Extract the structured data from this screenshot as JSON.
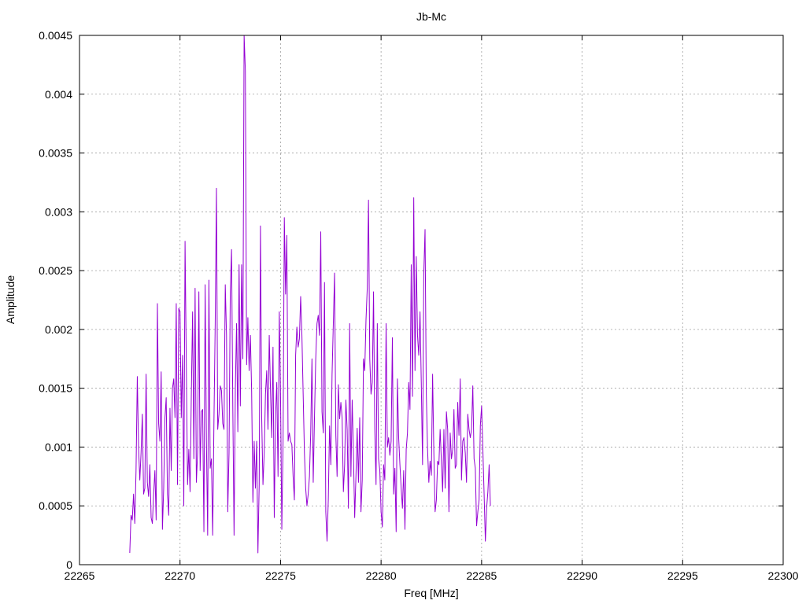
{
  "chart_data": {
    "type": "line",
    "title": "Jb-Mc",
    "xlabel": "Freq [MHz]",
    "ylabel": "Amplitude",
    "xlim": [
      22265,
      22300
    ],
    "ylim": [
      0,
      0.0045
    ],
    "x_ticks": [
      "22265",
      "22270",
      "22275",
      "22280",
      "22285",
      "22290",
      "22295",
      "22300"
    ],
    "y_ticks": [
      "0",
      "0.0005",
      "0.001",
      "0.0015",
      "0.002",
      "0.0025",
      "0.003",
      "0.0035",
      "0.004",
      "0.0045"
    ],
    "grid": true,
    "legend": "none",
    "series": [
      {
        "color": "#9400d3",
        "x_start": 22267.5,
        "x_step": 0.0625,
        "values": [
          0.0001,
          0.00042,
          0.00038,
          0.0006,
          0.00035,
          0.0008,
          0.0016,
          0.001,
          0.00072,
          0.00095,
          0.00128,
          0.0006,
          0.00065,
          0.00162,
          0.0007,
          0.00058,
          0.00085,
          0.0004,
          0.00035,
          0.0006,
          0.0008,
          0.00038,
          0.00222,
          0.0012,
          0.00105,
          0.00164,
          0.0003,
          0.00065,
          0.00125,
          0.00142,
          0.0006,
          0.00042,
          0.00133,
          0.0008,
          0.0015,
          0.00158,
          0.00125,
          0.00222,
          0.00068,
          0.00218,
          0.00215,
          0.00125,
          0.00178,
          0.0005,
          0.00275,
          0.0017,
          0.00068,
          0.00098,
          0.00062,
          0.00145,
          0.00215,
          0.0009,
          0.00235,
          0.0007,
          0.00095,
          0.00232,
          0.0008,
          0.0013,
          0.00132,
          0.00028,
          0.00238,
          0.00105,
          0.00025,
          0.00242,
          0.00082,
          0.0009,
          0.00025,
          0.00122,
          0.00205,
          0.0032,
          0.00115,
          0.00128,
          0.00152,
          0.00148,
          0.0012,
          0.00115,
          0.00238,
          0.00195,
          0.00045,
          0.00095,
          0.00232,
          0.00268,
          0.00135,
          0.00025,
          0.00148,
          0.00205,
          0.00113,
          0.00255,
          0.00135,
          0.00255,
          0.00175,
          0.0045,
          0.0042,
          0.0017,
          0.0021,
          0.00165,
          0.00195,
          0.00147,
          0.00053,
          0.00105,
          0.00065,
          0.00105,
          0.0001,
          0.00068,
          0.00288,
          0.00125,
          0.00068,
          0.00095,
          0.00145,
          0.00165,
          0.00115,
          0.00195,
          0.00148,
          0.00108,
          0.00185,
          0.0004,
          0.00125,
          0.00155,
          0.00075,
          0.00215,
          0.00143,
          0.0003,
          0.00105,
          0.00295,
          0.0023,
          0.0028,
          0.00105,
          0.00112,
          0.00105,
          0.00102,
          0.00075,
          0.00055,
          0.00178,
          0.00202,
          0.00185,
          0.00192,
          0.00228,
          0.00195,
          0.00145,
          0.00095,
          0.00065,
          0.0005,
          0.0006,
          0.00075,
          0.00112,
          0.00175,
          0.0007,
          0.00125,
          0.00175,
          0.00205,
          0.00212,
          0.00195,
          0.00283,
          0.0013,
          0.00112,
          0.0024,
          0.00045,
          0.0002,
          0.00055,
          0.00118,
          0.00085,
          0.00162,
          0.00205,
          0.00248,
          0.0011,
          0.00075,
          0.00153,
          0.00124,
          0.00138,
          0.00125,
          0.00062,
          0.00085,
          0.0014,
          0.00115,
          0.00048,
          0.00205,
          0.00075,
          0.0014,
          0.00095,
          0.0004,
          0.00075,
          0.00116,
          0.0007,
          0.00125,
          0.00045,
          0.00072,
          0.00175,
          0.00165,
          0.00208,
          0.00235,
          0.0031,
          0.00175,
          0.00145,
          0.00155,
          0.00232,
          0.00115,
          0.00068,
          0.00205,
          0.0009,
          0.0008,
          0.00045,
          0.00032,
          0.00085,
          0.00072,
          0.00205,
          0.001,
          0.00108,
          0.00093,
          0.00105,
          0.00193,
          0.0006,
          0.00082,
          0.00028,
          0.00158,
          0.00108,
          0.00085,
          0.00065,
          0.00048,
          0.0008,
          0.0003,
          0.00098,
          0.00112,
          0.00155,
          0.00132,
          0.00255,
          0.00143,
          0.00312,
          0.00165,
          0.00262,
          0.00195,
          0.00178,
          0.00215,
          0.00155,
          0.00085,
          0.00248,
          0.00285,
          0.00145,
          0.00098,
          0.0007,
          0.00088,
          0.00076,
          0.00162,
          0.00095,
          0.00045,
          0.00055,
          0.00088,
          0.00085,
          0.00115,
          0.00088,
          0.00062,
          0.00115,
          0.00065,
          0.0013,
          0.00115,
          0.00045,
          0.00112,
          0.0009,
          0.00098,
          0.00132,
          0.00082,
          0.00085,
          0.00138,
          0.0011,
          0.00158,
          0.00072,
          0.00105,
          0.00108,
          0.00095,
          0.0007,
          0.00128,
          0.00115,
          0.00108,
          0.00115,
          0.00152,
          0.0009,
          0.00082,
          0.00033,
          0.00045,
          0.00055,
          0.00118,
          0.00135,
          0.00098,
          0.0006,
          0.0002,
          0.00048,
          0.00062,
          0.00085,
          0.0005
        ]
      }
    ]
  }
}
